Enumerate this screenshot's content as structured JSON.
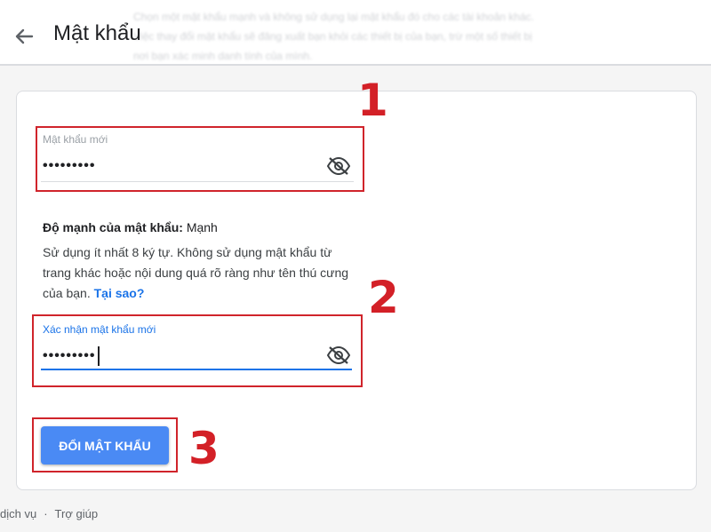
{
  "header": {
    "title": "Mật khẩu",
    "ghost_lines": [
      "Chọn một mật khẩu mạnh và không sử dụng lại mật khẩu đó cho các tài khoản khác.",
      "Việc thay đổi mật khẩu sẽ đăng xuất bạn khỏi các thiết bị của bạn, trừ một số thiết bị",
      "nơi bạn xác minh danh tính của mình."
    ]
  },
  "new_password": {
    "label": "Mật khẩu mới",
    "value": "•••••••••"
  },
  "strength": {
    "label": "Độ mạnh của mật khẩu:",
    "value": "Mạnh"
  },
  "hint": {
    "text": "Sử dụng ít nhất 8 ký tự. Không sử dụng mật khẩu từ trang khác hoặc nội dung quá rõ ràng như tên thú cưng của bạn.",
    "link": "Tại sao?"
  },
  "confirm_password": {
    "label": "Xác nhận mật khẩu mới",
    "value": "•••••••••"
  },
  "submit_label": "ĐỔI MẬT KHẨU",
  "annotations": [
    "1",
    "2",
    "3"
  ],
  "footer": {
    "services": "dịch vụ",
    "separator": "·",
    "help": "Trợ giúp"
  },
  "colors": {
    "accent": "#1a73e8",
    "button": "#4a8af4",
    "annotation_red": "#d0242b"
  }
}
